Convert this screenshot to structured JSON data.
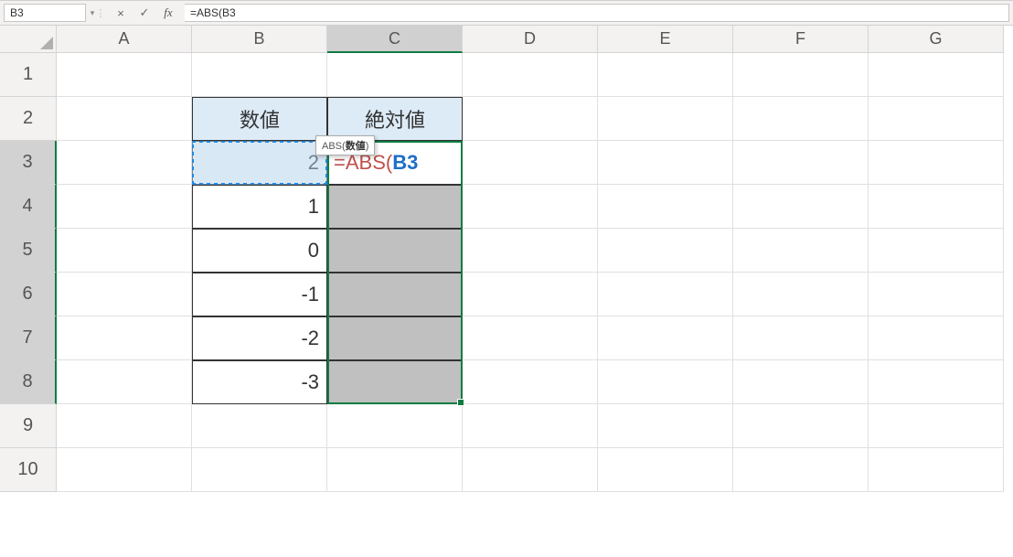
{
  "formula_bar": {
    "name_box": "B3",
    "cancel_symbol": "×",
    "enter_symbol": "✓",
    "fx_symbol": "fx",
    "formula_text": "=ABS(B3"
  },
  "columns": [
    "A",
    "B",
    "C",
    "D",
    "E",
    "F",
    "G"
  ],
  "selected_column": "C",
  "rows": [
    "1",
    "2",
    "3",
    "4",
    "5",
    "6",
    "7",
    "8",
    "9",
    "10"
  ],
  "selected_rows": [
    "3",
    "4",
    "5",
    "6",
    "7",
    "8"
  ],
  "table": {
    "header_b": "数値",
    "header_c": "絶対値",
    "b_values": [
      "2",
      "1",
      "0",
      "-1",
      "-2",
      "-3"
    ]
  },
  "editing_cell": {
    "address": "C3",
    "parts": {
      "eq": "=",
      "fn": "ABS",
      "open": "(",
      "ref": "B3"
    }
  },
  "tooltip": {
    "fn": "ABS(",
    "arg": "数値",
    "close": ")"
  },
  "referenced_cell": "B3",
  "selection_range": "C3:C8"
}
